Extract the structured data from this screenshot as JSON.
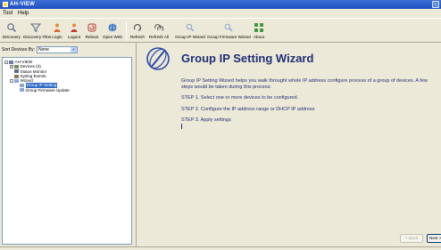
{
  "window": {
    "title": "AH-VIEW",
    "control_glyph": "-",
    "title_color": "#1e4fc0"
  },
  "menu": [
    "Tool",
    "Help"
  ],
  "toolbar": {
    "buttons": [
      {
        "name": "discovery",
        "label": "Discovery",
        "icon": "magnifier-icon"
      },
      {
        "name": "discovery-filter",
        "label": "Discovery Filter",
        "icon": "funnel-icon"
      },
      {
        "name": "login",
        "label": "Login",
        "icon": "user-login-icon"
      },
      {
        "name": "logout",
        "label": "Logout",
        "icon": "user-logout-icon"
      },
      {
        "name": "reboot",
        "label": "Reboot",
        "icon": "reboot-icon"
      },
      {
        "name": "open-web",
        "label": "Open Web",
        "icon": "globe-icon"
      },
      {
        "name": "refresh",
        "label": "Refresh",
        "icon": "refresh-icon"
      },
      {
        "name": "refresh-all",
        "label": "Refresh All",
        "icon": "refresh-all-icon"
      },
      {
        "name": "group-ip-wizard",
        "label": "Group IP Wizard",
        "icon": "ip-wizard-icon"
      },
      {
        "name": "group-firmware-wizard",
        "label": "Group Firmware Wizard",
        "icon": "firmware-wizard-icon"
      },
      {
        "name": "about",
        "label": "About",
        "icon": "about-icon"
      }
    ]
  },
  "left_panel": {
    "filter_label": "Sort Devices By:",
    "filter_value": "None",
    "filter_arrow": "▼",
    "tree": [
      {
        "label": "AH-VIEW",
        "level": 0,
        "expander": "-",
        "icon": "computer-icon"
      },
      {
        "label": "Devices (3)",
        "level": 1,
        "expander": "+",
        "icon": "devices-icon"
      },
      {
        "label": "Status Monitor",
        "level": 1,
        "expander": "",
        "icon": "monitor-icon"
      },
      {
        "label": "Syslog Events",
        "level": 1,
        "expander": "",
        "icon": "syslog-icon"
      },
      {
        "label": "Wizard",
        "level": 1,
        "expander": "-",
        "icon": "wizard-icon"
      },
      {
        "label": "Group IP Setting",
        "level": 2,
        "expander": "",
        "icon": "wizard-item-icon",
        "selected": true
      },
      {
        "label": "Group Firmware Update",
        "level": 2,
        "expander": "",
        "icon": "wizard-item-icon"
      }
    ]
  },
  "wizard": {
    "title": "Group IP Setting Wizard",
    "intro": "Group IP Setting Wizard helps you walk throught whole IP address configure process of a group of devices. A few steps would be taken during this process:",
    "steps": [
      "STEP 1. Select one or more devices to be configured.",
      "STEP 2. Configure the IP address range or DHCP IP address",
      "STEP 3. Apply settings"
    ],
    "back_label": "< Back",
    "next_label": "Next >",
    "text_color": "#1f2f74"
  }
}
